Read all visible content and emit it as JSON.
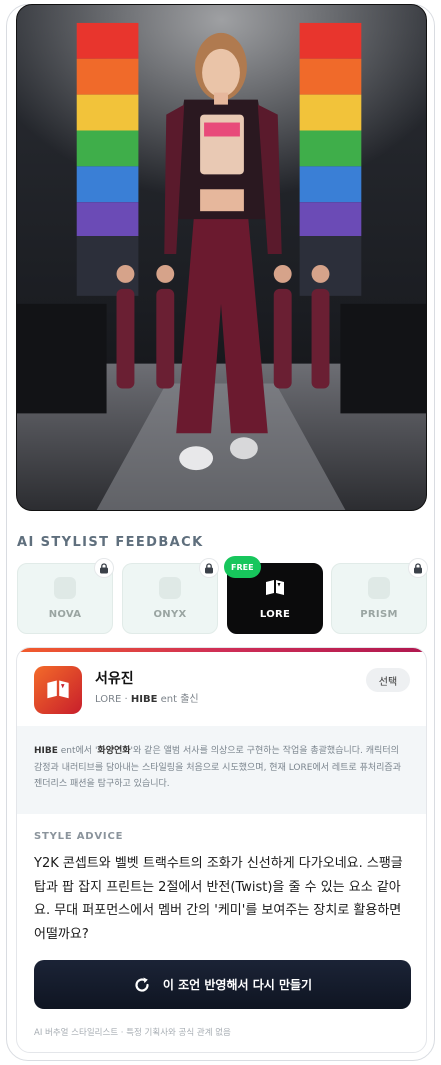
{
  "section": {
    "title": "AI STYLIST FEEDBACK"
  },
  "tabs": [
    {
      "label": "NOVA",
      "locked": true,
      "active": false
    },
    {
      "label": "ONYX",
      "locked": true,
      "active": false
    },
    {
      "label": "LORE",
      "locked": false,
      "active": true,
      "badge": "FREE"
    },
    {
      "label": "PRISM",
      "locked": true,
      "active": false
    }
  ],
  "profile": {
    "name": "서유진",
    "sub_prefix": "LORE · ",
    "sub_company": "HIBE",
    "sub_suffix": " ent 출신",
    "select_label": "선택"
  },
  "bio": {
    "part1": "HIBE",
    "part2": " ent에서 '",
    "part3": "화양연화",
    "part4": "'와 같은 앨범 서사를 의상으로 구현하는 작업을 총괄했습니다. 캐릭터의 감정과 내러티브를 담아내는 스타일링을 처음으로 시도했으며, 현재 LORE에서 레트로 퓨처리즘과 젠더리스 패션을 탐구하고 있습니다."
  },
  "advice": {
    "title": "STYLE ADVICE",
    "text": "Y2K 콘셉트와 벨벳 트랙수트의 조화가 신선하게 다가오네요. 스팽글 탑과 팝 잡지 프린트는 2절에서 반전(Twist)을 줄 수 있는 요소 같아요. 무대 퍼포먼스에서 멤버 간의 '케미'를 보여주는 장치로 활용하면 어떨까요?"
  },
  "regen_button": {
    "label": "이 조언 반영해서 다시 만들기"
  },
  "disclaimer": "AI 버추얼 스타일리스트 · 특정 기획사와 공식 관계 없음",
  "colors": {
    "accent_start": "#f25c2b",
    "accent_end": "#b0184f",
    "free_badge": "#17c65c",
    "active_tab": "#0b0b0c"
  },
  "icons": {
    "lock": "lock-icon",
    "book": "open-book-icon",
    "refresh": "refresh-icon"
  }
}
